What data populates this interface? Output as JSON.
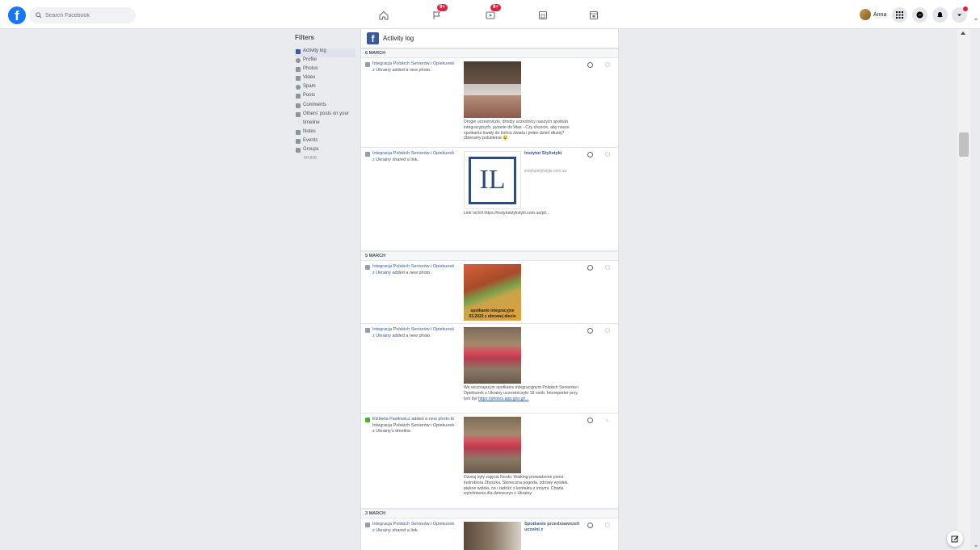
{
  "topbar": {
    "logo": "f",
    "search_placeholder": "Search Facebook",
    "nav": [
      {
        "icon": "home-icon"
      },
      {
        "icon": "flag-icon",
        "badge": "9+"
      },
      {
        "icon": "video-icon",
        "badge": "9+"
      },
      {
        "icon": "marketplace-icon"
      },
      {
        "icon": "gaming-icon"
      }
    ],
    "profile_name": "Anna"
  },
  "filters": {
    "title": "Filters",
    "items": [
      {
        "label": "Activity log",
        "active": true
      },
      {
        "label": "Profile"
      },
      {
        "label": "Photos"
      },
      {
        "label": "Video"
      },
      {
        "label": "Spam"
      },
      {
        "label": "Posts"
      },
      {
        "label": "Comments"
      },
      {
        "label": "Others' posts on your"
      },
      {
        "label": "timeline"
      },
      {
        "label": "Notes"
      },
      {
        "label": "Events"
      },
      {
        "label": "Groups"
      }
    ],
    "more": "MORE"
  },
  "main": {
    "title": "Activity log",
    "dates": [
      "6 MARCH",
      "5 MARCH",
      "3 MARCH"
    ],
    "entries": [
      {
        "actor": "Integracja Polskich Seniorów i Opiekunek z Ukrainy",
        "action": "added a new photo.",
        "caption": "Drogie uczestniczki, drodzy uczestnicy naszych spotkań integracyjnych, pytanie do Was - Czy chcecie, aby nasze spotkania trwały do końca świata i jeden dzień dłużej? Zbieramy polubienia 😉"
      },
      {
        "actor": "Integracja Polskich Seniorów i Opiekunek z Ukrainy",
        "action": "shared a link.",
        "link_title": "Instytut Stylistyki",
        "link_url": "instytutstylistyki.com.ua",
        "caption": "Link od Eli https://instytutstylistyki.com.ua/pl/..."
      },
      {
        "actor": "Integracja Polskich Seniorów i Opiekunek z Ukrainy",
        "action": "added a new photo.",
        "image_text": "spotkanie integracyjne 03.2022 z obrowej diecie"
      },
      {
        "actor": "Integracja Polskich Seniorów i Opiekunek z Ukrainy",
        "action": "added a new photo.",
        "caption": "We wczorajszym spotkaniu integracyjnym Polskich Seniorów i Opiekunek z Ukrainy uczestniczyło 18 osób. fotoreporter przy tym był",
        "caption_link": "https://photos.app.goo.gl/..."
      },
      {
        "actor": "Elżbieta Pawłowicz",
        "action": "added a",
        "action_link": "new photo",
        "action_tail": "to Integracja Polskich Seniorów i Opiekunek z Ukrainy's timeline.",
        "caption": "Dzisiaj były zajęcia Nordic Walking prowadzone przez instruktora Zbyszka. Słoneczna pogoda, zdrowy wysiłek, piękne widoki, no i radość z kontaktu z innymi. Chwila wytchnienia dla dziewczyn z Ukrainy."
      },
      {
        "actor": "Integracja Polskich Seniorów i Opiekunek z Ukrainy",
        "action": "shared a link.",
        "link_title": "Spotkanie przedstawicieli uczelni z"
      }
    ]
  }
}
